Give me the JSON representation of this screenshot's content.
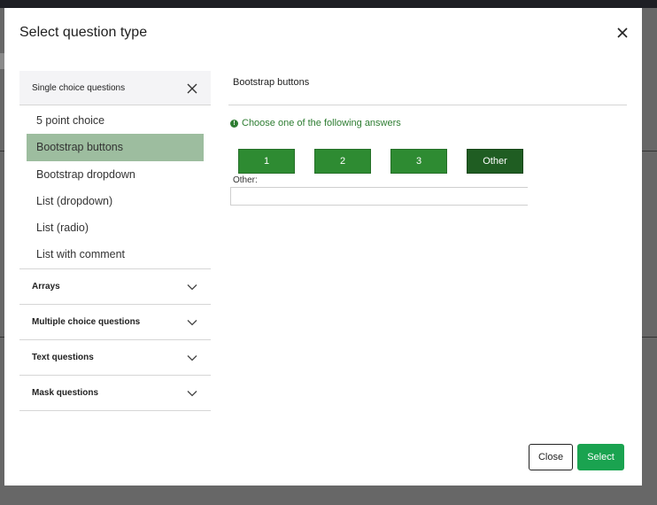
{
  "modal": {
    "title": "Select question type"
  },
  "sidebar": {
    "open_group": {
      "label": "Single choice questions",
      "items": [
        {
          "label": "5 point choice",
          "selected": false
        },
        {
          "label": "Bootstrap buttons",
          "selected": true
        },
        {
          "label": "Bootstrap dropdown",
          "selected": false
        },
        {
          "label": "List (dropdown)",
          "selected": false
        },
        {
          "label": "List (radio)",
          "selected": false
        },
        {
          "label": "List with comment",
          "selected": false
        }
      ]
    },
    "groups": [
      {
        "label": "Arrays"
      },
      {
        "label": "Multiple choice questions"
      },
      {
        "label": "Text questions"
      },
      {
        "label": "Mask questions"
      }
    ]
  },
  "preview": {
    "title": "Bootstrap buttons",
    "hint": "Choose one of the following answers",
    "answers": [
      "1",
      "2",
      "3",
      "Other"
    ],
    "active_answer": "Other",
    "other_label": "Other:",
    "other_value": ""
  },
  "footer": {
    "close_label": "Close",
    "select_label": "Select"
  },
  "colors": {
    "selected_item_bg": "#9dbd9f",
    "answer_button": "#2e8b32",
    "answer_button_active": "#1f5d22",
    "hint_text": "#2e7d32",
    "select_button": "#1aa350"
  }
}
